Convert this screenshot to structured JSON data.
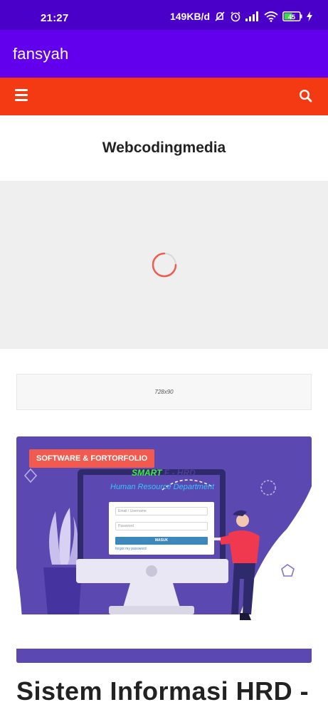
{
  "status_bar": {
    "time": "21:27",
    "network_speed": "149KB/d",
    "battery_level": "45",
    "icons": [
      "mute-icon",
      "alarm-icon",
      "signal-icon",
      "wifi-icon",
      "battery-icon",
      "charging-icon"
    ]
  },
  "app_bar": {
    "title": "fansyah"
  },
  "site_nav": {
    "menu_icon": "hamburger-menu-icon",
    "search_icon": "search-icon"
  },
  "site": {
    "brand": "Webcodingmedia"
  },
  "ad": {
    "label": "728x90"
  },
  "feature": {
    "badge": "SOFTWARE & FORTORFOLIO",
    "app_title_accent": "SMART",
    "app_title_rest": "F - HRD",
    "app_subtitle": "Human Resource Department",
    "login_email_placeholder": "Email / Username",
    "login_password_placeholder": "Password",
    "login_button": "MASUK",
    "login_forgot": "forgot my password"
  },
  "post": {
    "title": "Sistem Informasi HRD -"
  },
  "colors": {
    "status_bar": "#4a00c9",
    "app_bar": "#6200ee",
    "site_nav": "#f33a13",
    "feature_bg": "#5b48b0",
    "badge": "#f15b4f",
    "spinner": "#f15b4f"
  }
}
